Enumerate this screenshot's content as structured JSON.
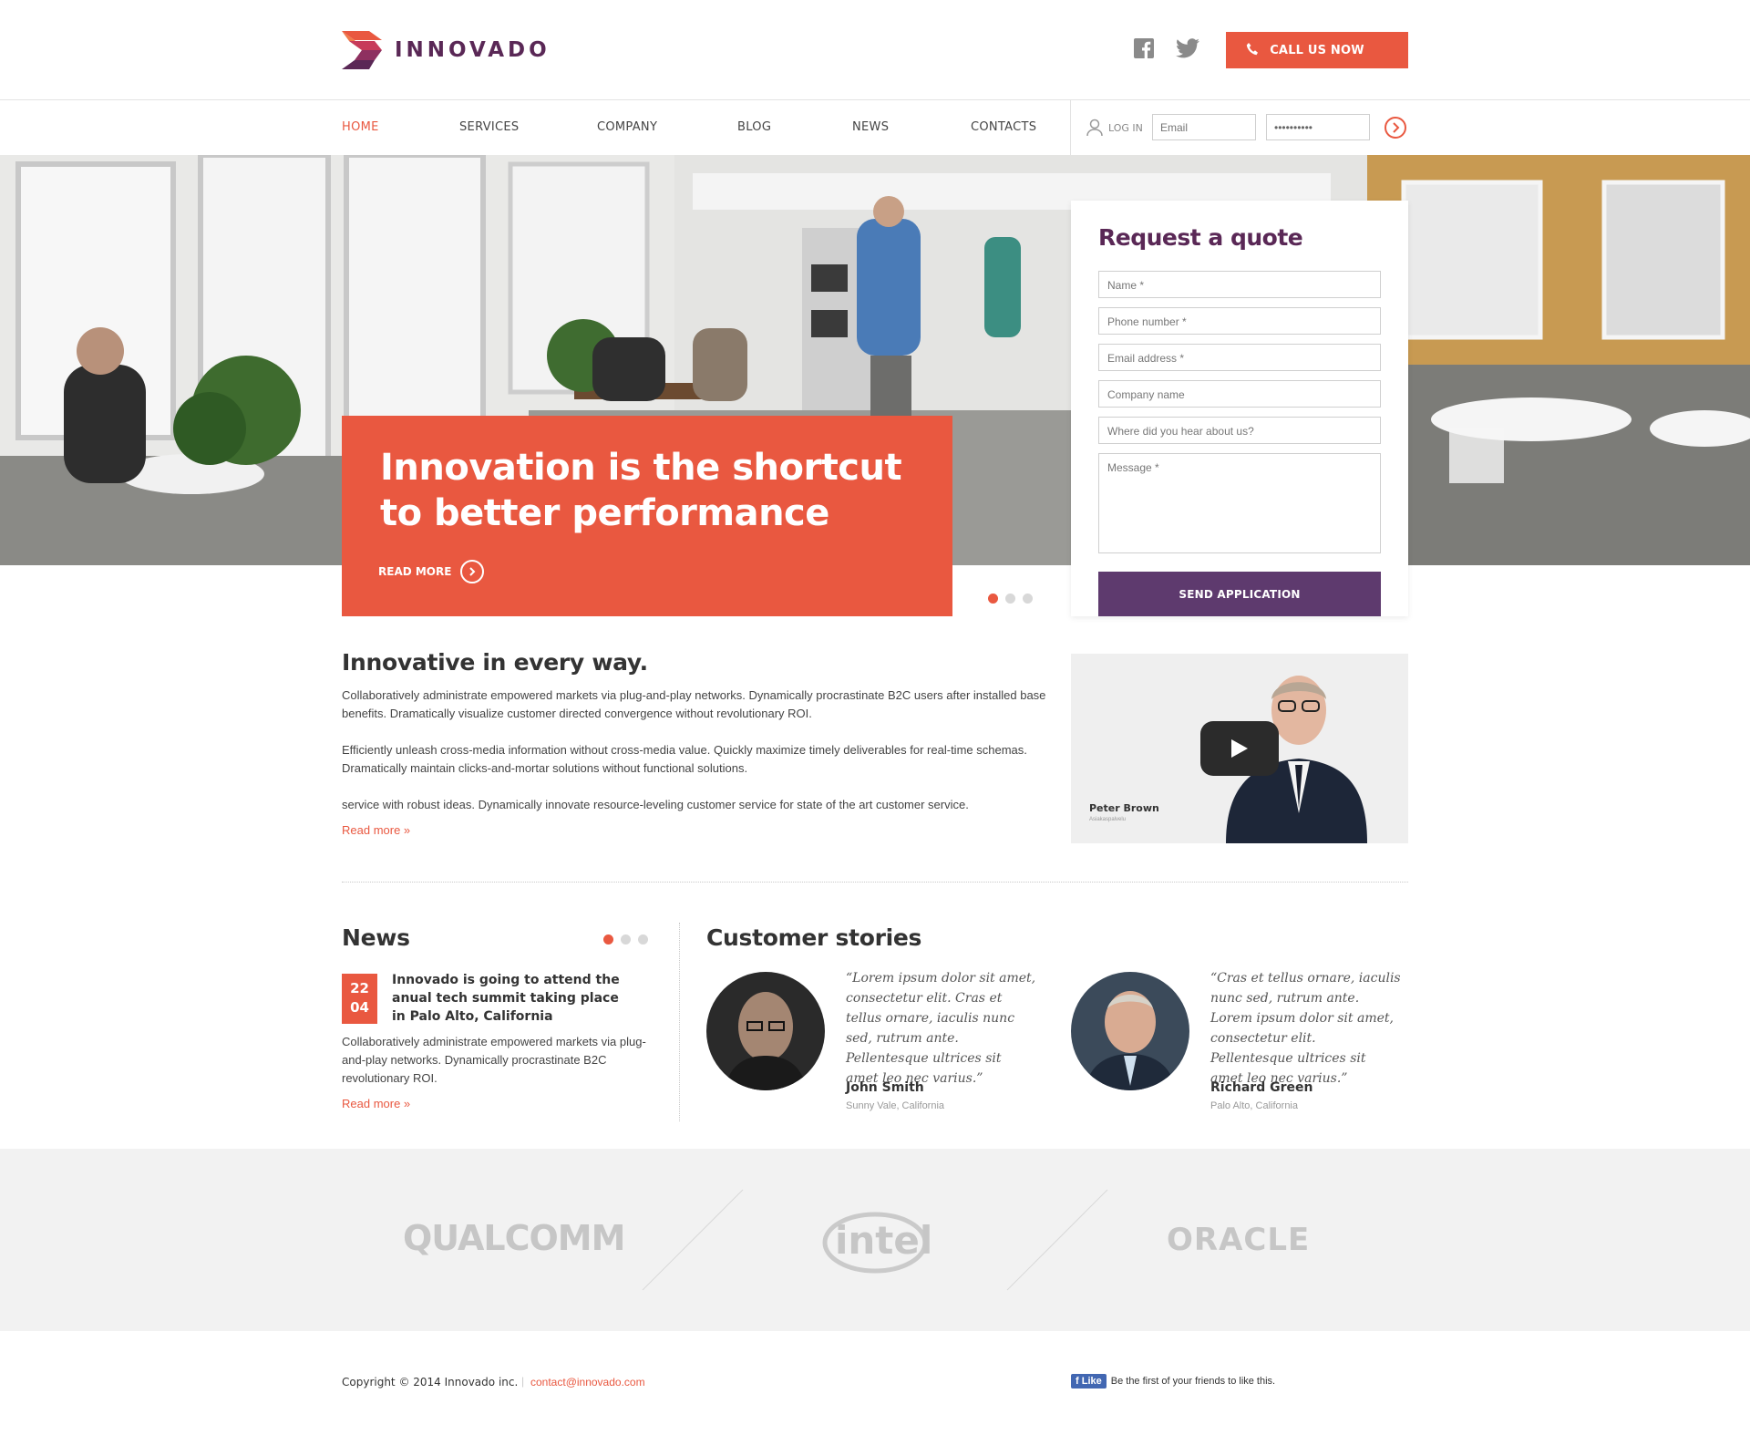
{
  "header": {
    "brand": "INNOVADO",
    "call_button": "CALL US NOW",
    "social": [
      "facebook-icon",
      "twitter-icon"
    ]
  },
  "nav": {
    "items": [
      "HOME",
      "SERVICES",
      "COMPANY",
      "BLOG",
      "NEWS",
      "CONTACTS"
    ],
    "active": "HOME",
    "login_label": "LOG IN",
    "email_placeholder": "Email",
    "password_value": "••••••••••"
  },
  "hero": {
    "title": "Innovation is the shortcut to better performance",
    "read_more": "READ MORE",
    "slides": 3,
    "active_slide": 1
  },
  "quote_form": {
    "title": "Request a quote",
    "fields": [
      "Name *",
      "Phone number *",
      "Email address *",
      "Company name",
      "Where did you hear about us?",
      "Message *"
    ],
    "submit": "SEND APPLICATION"
  },
  "intro": {
    "heading": "Innovative in every way.",
    "p1": "Collaboratively administrate empowered markets via plug-and-play networks. Dynamically procrastinate B2C users after installed base benefits. Dramatically visualize customer directed convergence without revolutionary ROI.",
    "p2": "Efficiently unleash cross-media information without cross-media value. Quickly maximize timely deliverables for real-time schemas. Dramatically maintain clicks-and-mortar solutions without functional solutions.",
    "p3": "service with robust ideas. Dynamically innovate resource-leveling customer service for state of the art customer service.",
    "read_more": "Read more »"
  },
  "video": {
    "person_name": "Peter Brown",
    "person_title": "Asiakaspalvelu"
  },
  "news": {
    "heading": "News",
    "day": "22",
    "month": "04",
    "headline": "Innovado is going to attend the anual tech summit taking place in Palo Alto, California",
    "body": "Collaboratively administrate empowered markets via plug-and-play networks. Dynamically procrastinate B2C revolutionary ROI.",
    "read_more": "Read more »",
    "active_dot": 1
  },
  "stories": {
    "heading": "Customer stories",
    "items": [
      {
        "quote": "“Lorem ipsum dolor sit amet, consectetur elit. Cras et tellus ornare, iaculis nunc sed, rutrum ante. Pellentesque ultrices sit amet leo nec varius.”",
        "name": "John Smith",
        "location": "Sunny Vale, California"
      },
      {
        "quote": "“Cras et tellus ornare, iaculis nunc sed, rutrum ante. Lorem ipsum dolor sit amet, consectetur elit. Pellentesque ultrices sit amet leo nec varius.”",
        "name": "Richard Green",
        "location": "Palo Alto, California"
      }
    ]
  },
  "partners": [
    "QUALCOMM",
    "intel",
    "ORACLE"
  ],
  "footer": {
    "copyright": "Copyright © 2014 Innovado inc.",
    "email": "contact@innovado.com",
    "fb_like": "Like",
    "fb_text": "Be the first of your friends to like this."
  },
  "colors": {
    "accent": "#e95840",
    "brand_purple": "#5a2856",
    "button_purple": "#5e3a6e"
  }
}
